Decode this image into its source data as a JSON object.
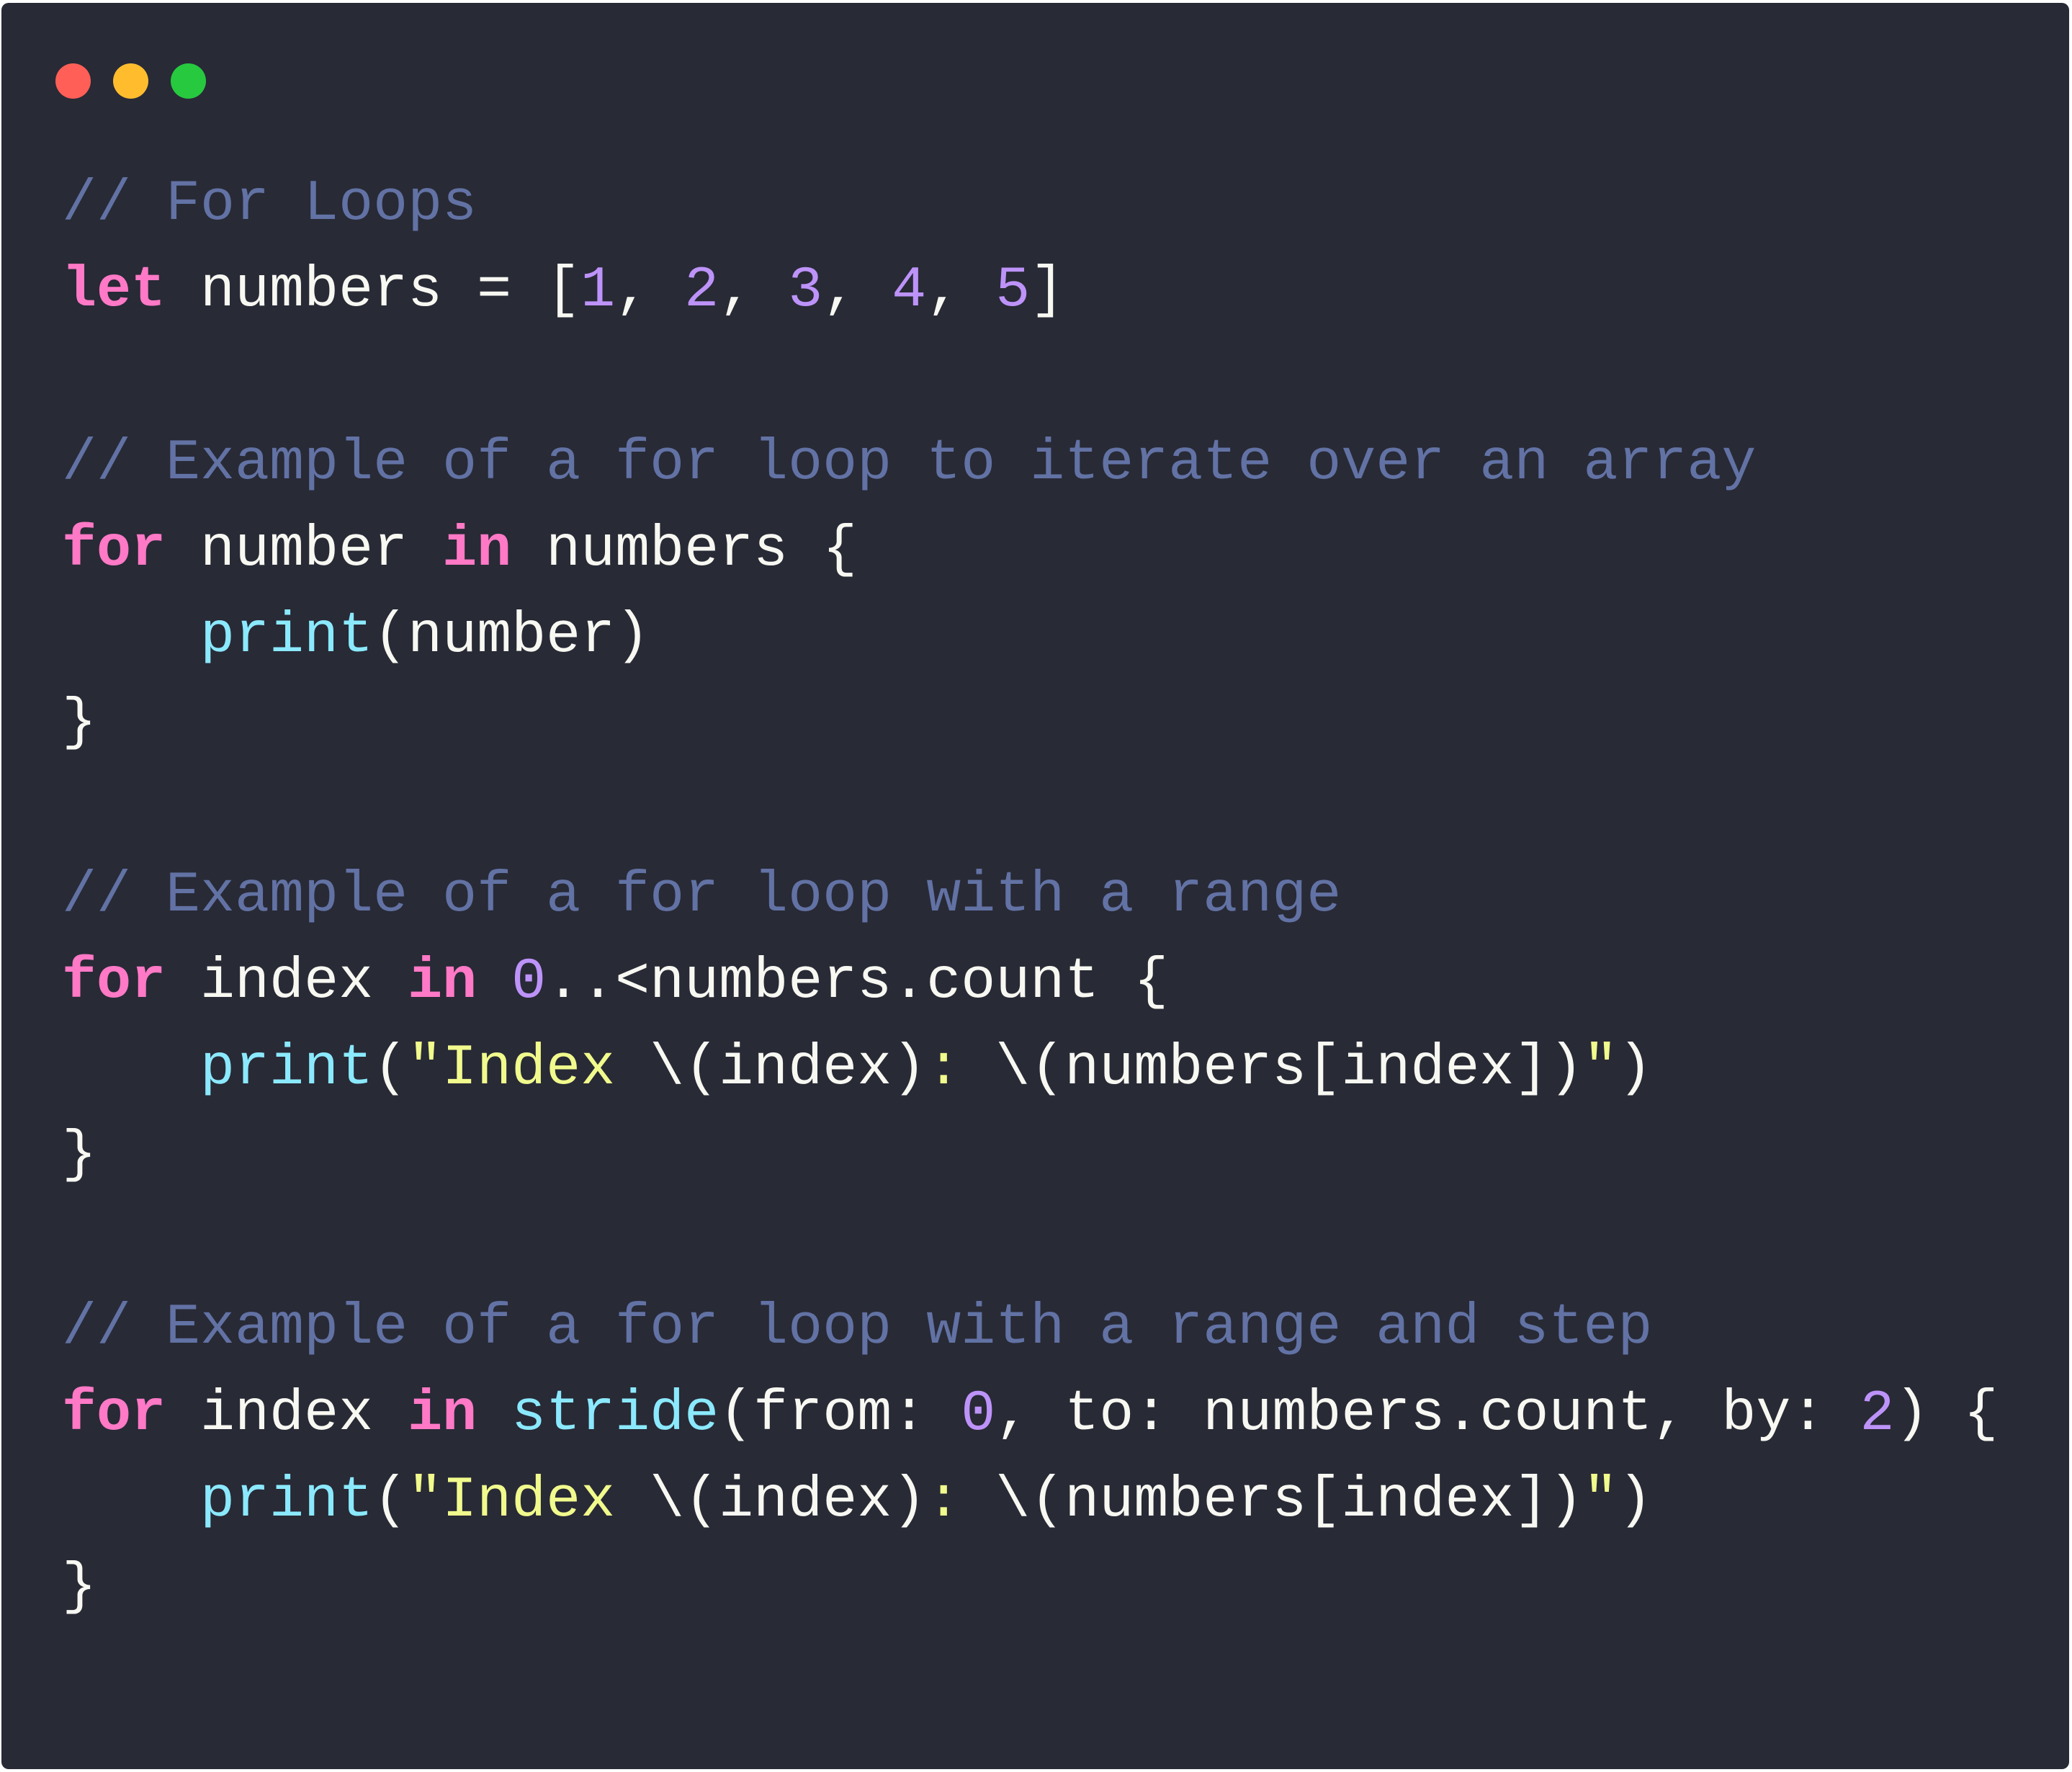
{
  "window": {
    "traffic_lights": [
      {
        "name": "close",
        "color": "#ff5f56"
      },
      {
        "name": "minimize",
        "color": "#ffbd2e"
      },
      {
        "name": "zoom",
        "color": "#27c93f"
      }
    ]
  },
  "theme": {
    "background": "#282a36",
    "comment": "#6272a4",
    "keyword": "#ff79c6",
    "function": "#8be9fd",
    "number": "#bd93f9",
    "string": "#f1fa8c",
    "plain": "#f8f8f2"
  },
  "code": {
    "language": "swift",
    "lines": [
      [
        {
          "t": "comment",
          "v": "// For Loops"
        }
      ],
      [
        {
          "t": "keyword",
          "v": "let"
        },
        {
          "t": "plain",
          "v": " numbers = ["
        },
        {
          "t": "number",
          "v": "1"
        },
        {
          "t": "plain",
          "v": ", "
        },
        {
          "t": "number",
          "v": "2"
        },
        {
          "t": "plain",
          "v": ", "
        },
        {
          "t": "number",
          "v": "3"
        },
        {
          "t": "plain",
          "v": ", "
        },
        {
          "t": "number",
          "v": "4"
        },
        {
          "t": "plain",
          "v": ", "
        },
        {
          "t": "number",
          "v": "5"
        },
        {
          "t": "plain",
          "v": "]"
        }
      ],
      [],
      [
        {
          "t": "comment",
          "v": "// Example of a for loop to iterate over an array"
        }
      ],
      [
        {
          "t": "keyword",
          "v": "for"
        },
        {
          "t": "plain",
          "v": " number "
        },
        {
          "t": "keyword",
          "v": "in"
        },
        {
          "t": "plain",
          "v": " numbers {"
        }
      ],
      [
        {
          "t": "plain",
          "v": "    "
        },
        {
          "t": "function",
          "v": "print"
        },
        {
          "t": "plain",
          "v": "(number)"
        }
      ],
      [
        {
          "t": "plain",
          "v": "}"
        }
      ],
      [],
      [
        {
          "t": "comment",
          "v": "// Example of a for loop with a range"
        }
      ],
      [
        {
          "t": "keyword",
          "v": "for"
        },
        {
          "t": "plain",
          "v": " index "
        },
        {
          "t": "keyword",
          "v": "in"
        },
        {
          "t": "plain",
          "v": " "
        },
        {
          "t": "number",
          "v": "0"
        },
        {
          "t": "plain",
          "v": "..<numbers.count {"
        }
      ],
      [
        {
          "t": "plain",
          "v": "    "
        },
        {
          "t": "function",
          "v": "print"
        },
        {
          "t": "plain",
          "v": "("
        },
        {
          "t": "string",
          "v": "\"Index "
        },
        {
          "t": "plain",
          "v": "\\(index)"
        },
        {
          "t": "string",
          "v": ": "
        },
        {
          "t": "plain",
          "v": "\\(numbers[index])"
        },
        {
          "t": "string",
          "v": "\""
        },
        {
          "t": "plain",
          "v": ")"
        }
      ],
      [
        {
          "t": "plain",
          "v": "}"
        }
      ],
      [],
      [
        {
          "t": "comment",
          "v": "// Example of a for loop with a range and step"
        }
      ],
      [
        {
          "t": "keyword",
          "v": "for"
        },
        {
          "t": "plain",
          "v": " index "
        },
        {
          "t": "keyword",
          "v": "in"
        },
        {
          "t": "plain",
          "v": " "
        },
        {
          "t": "function",
          "v": "stride"
        },
        {
          "t": "plain",
          "v": "(from: "
        },
        {
          "t": "number",
          "v": "0"
        },
        {
          "t": "plain",
          "v": ", to: numbers.count, by: "
        },
        {
          "t": "number",
          "v": "2"
        },
        {
          "t": "plain",
          "v": ") {"
        }
      ],
      [
        {
          "t": "plain",
          "v": "    "
        },
        {
          "t": "function",
          "v": "print"
        },
        {
          "t": "plain",
          "v": "("
        },
        {
          "t": "string",
          "v": "\"Index "
        },
        {
          "t": "plain",
          "v": "\\(index)"
        },
        {
          "t": "string",
          "v": ": "
        },
        {
          "t": "plain",
          "v": "\\(numbers[index])"
        },
        {
          "t": "string",
          "v": "\""
        },
        {
          "t": "plain",
          "v": ")"
        }
      ],
      [
        {
          "t": "plain",
          "v": "}"
        }
      ]
    ]
  }
}
